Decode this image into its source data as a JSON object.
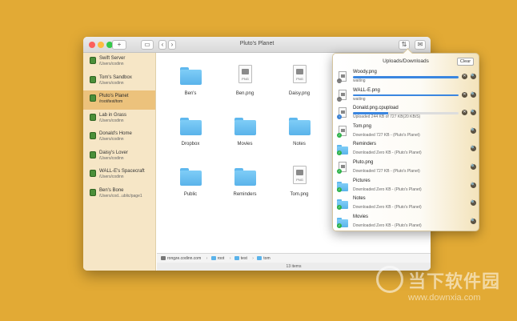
{
  "window": {
    "title": "Pluto's Planet",
    "add_button": "+",
    "back": "‹",
    "forward": "›"
  },
  "sidebar": {
    "items": [
      {
        "name": "Swift Server",
        "path": "/Users/codinn",
        "active": false
      },
      {
        "name": "Tom's Sandbox",
        "path": "/Users/codinn",
        "active": false
      },
      {
        "name": "Pluto's Planet",
        "path": "/root/test/tom",
        "active": true
      },
      {
        "name": "Lab in Grass",
        "path": "/Users/codinn",
        "active": false
      },
      {
        "name": "Donald's Home",
        "path": "/Users/codinn",
        "active": false
      },
      {
        "name": "Daisy's Lover",
        "path": "/Users/codinn",
        "active": false
      },
      {
        "name": "WALL-E's Spacecraft",
        "path": "/Users/codinn",
        "active": false
      },
      {
        "name": "Ben's Bone",
        "path": "/Users/cod...ublic/page1",
        "active": false
      }
    ]
  },
  "files": [
    {
      "name": "Ben's",
      "kind": "folder"
    },
    {
      "name": "Ben.png",
      "kind": "png"
    },
    {
      "name": "Daisy.png",
      "kind": "png"
    },
    {
      "name": "Dropbox",
      "kind": "folder"
    },
    {
      "name": "Movies",
      "kind": "folder"
    },
    {
      "name": "Notes",
      "kind": "folder"
    },
    {
      "name": "Public",
      "kind": "folder"
    },
    {
      "name": "Reminders",
      "kind": "folder"
    },
    {
      "name": "Tom.png",
      "kind": "png"
    }
  ],
  "png_tag": "PNG",
  "pathbar": {
    "host": "rongze.codinn.com",
    "segments": [
      "root",
      "test",
      "tom"
    ]
  },
  "status": "13 items",
  "popover": {
    "title": "Uploads/Downloads",
    "clear_label": "Clear",
    "tasks": [
      {
        "name": "Woody.png",
        "status": "waiting",
        "progress": 1.0,
        "icon": "file-small",
        "badge": "wait"
      },
      {
        "name": "WALL-E.png",
        "status": "waiting",
        "progress": 1.0,
        "icon": "file-small",
        "badge": "wait"
      },
      {
        "name": "Donald.png.cpupload",
        "status": "Uploaded 244 KB of 727 KB(20 KB/S)",
        "progress": 0.33,
        "icon": "file-small",
        "badge": "up"
      },
      {
        "name": "Tom.png",
        "status": "Downloaded 727 KB - (Pluto's Planet)",
        "progress": null,
        "icon": "file-small",
        "badge": "done"
      },
      {
        "name": "Reminders",
        "status": "Downloaded Zero KB - (Pluto's Planet)",
        "progress": null,
        "icon": "folder-small",
        "badge": "done"
      },
      {
        "name": "Pluto.png",
        "status": "Downloaded 727 KB - (Pluto's Planet)",
        "progress": null,
        "icon": "file-small",
        "badge": "done"
      },
      {
        "name": "Pictures",
        "status": "Downloaded Zero KB - (Pluto's Planet)",
        "progress": null,
        "icon": "folder-small",
        "badge": "done"
      },
      {
        "name": "Notes",
        "status": "Downloaded Zero KB - (Pluto's Planet)",
        "progress": null,
        "icon": "folder-small",
        "badge": "done"
      },
      {
        "name": "Movies",
        "status": "Downloaded Zero KB - (Pluto's Planet)",
        "progress": null,
        "icon": "folder-small",
        "badge": "done"
      }
    ]
  },
  "watermark": {
    "text": "当下软件园",
    "url": "www.downxia.com"
  },
  "colors": {
    "desktop": "#e2aa35",
    "sidebar": "#f6e6c6",
    "sidebar_active": "#ecc27c",
    "progress": "#3a86e0",
    "folder": "#5ab3ea"
  }
}
